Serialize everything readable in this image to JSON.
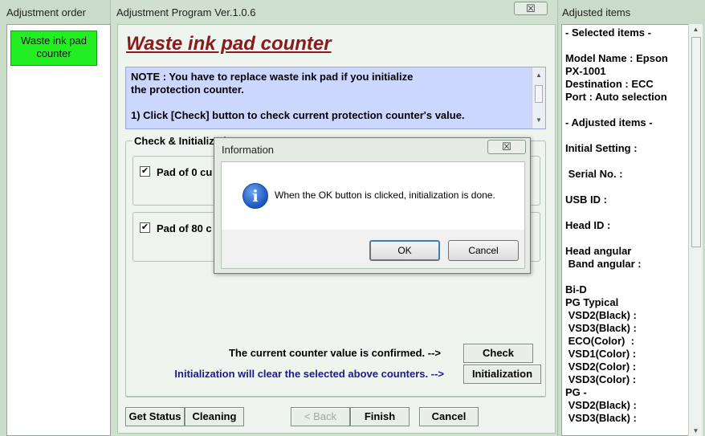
{
  "left_pane": {
    "title": "Adjustment order",
    "items": [
      {
        "label": "Waste ink pad counter"
      }
    ]
  },
  "main": {
    "title": "Adjustment Program Ver.1.0.6",
    "close_label": "☒",
    "page_title": "Waste ink pad counter",
    "note_lines": [
      "NOTE : You have to replace waste ink pad if you initialize",
      "the protection counter.",
      "",
      "1) Click [Check] button to check current protection counter's value."
    ],
    "group_title": "Check & Initializatio",
    "pads": [
      {
        "label": "Pad  of  0 cu",
        "checked": true
      },
      {
        "label": "Pad  of 80 c",
        "checked": true
      }
    ],
    "confirmed_text": "The current counter value is confirmed. -->",
    "init_warning": "Initialization will clear the selected above counters. -->",
    "check_button": "Check",
    "initialization_button": "Initialization",
    "get_status_button": "Get Status",
    "cleaning_button": "Cleaning",
    "back_button": "< Back",
    "finish_button": "Finish",
    "cancel_button": "Cancel"
  },
  "right_pane": {
    "title": "Adjusted items",
    "rows": [
      "- Selected items -",
      "",
      "Model Name : Epson",
      "PX-1001",
      "Destination : ECC",
      "Port : Auto selection",
      "",
      "- Adjusted items -",
      "",
      "Initial Setting :",
      "",
      " Serial No. :",
      "",
      "USB ID :",
      "",
      "Head ID :",
      "",
      "Head angular",
      " Band angular :",
      "",
      "Bi-D",
      "PG Typical",
      " VSD2(Black) :",
      " VSD3(Black) :",
      " ECO(Color)  :",
      " VSD1(Color) :",
      " VSD2(Color) :",
      " VSD3(Color) :",
      "PG -",
      " VSD2(Black) :",
      " VSD3(Black) :"
    ]
  },
  "dialog": {
    "title": "Information",
    "close_label": "☒",
    "message": "When the OK button is clicked, initialization is done.",
    "ok_button": "OK",
    "cancel_button": "Cancel"
  },
  "icons": {
    "dialog_icon": "info-icon",
    "checkbox": "checkmark"
  },
  "colors": {
    "page_title": "#8b1a1a",
    "note_bg": "#ccd7ff",
    "waste_button": "#22ee22",
    "init_warning": "#1a1a8c"
  }
}
